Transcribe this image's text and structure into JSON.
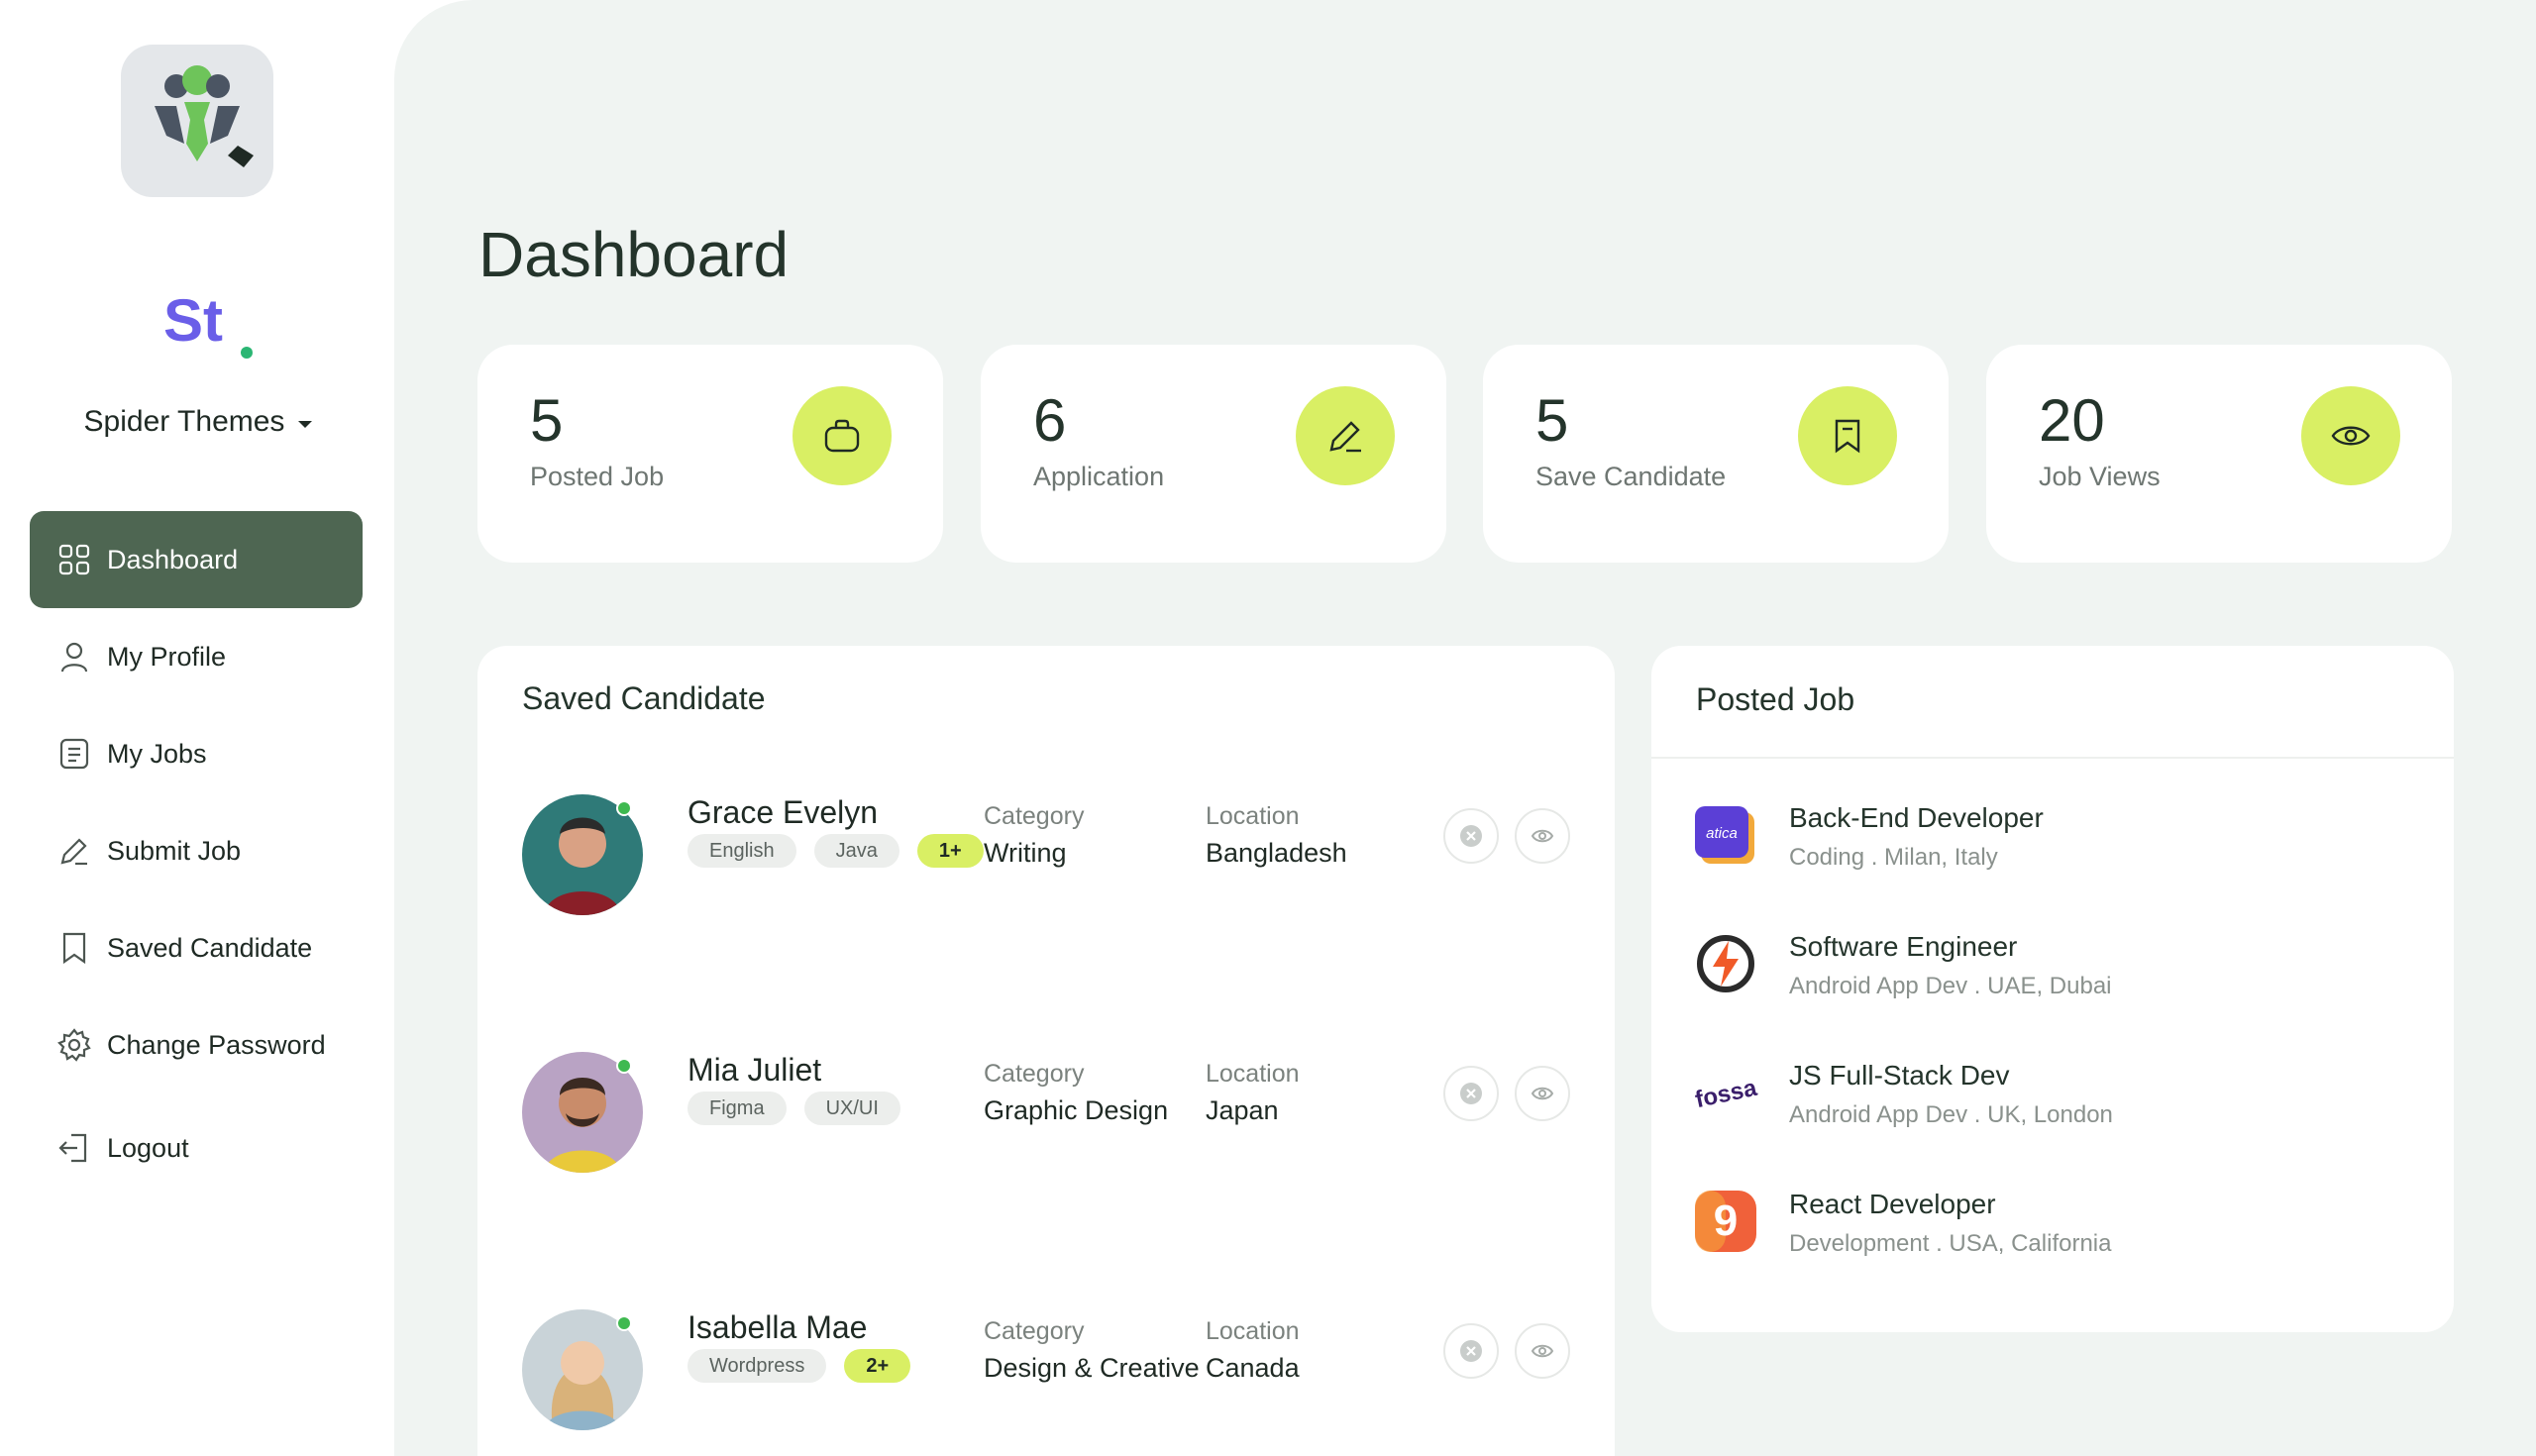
{
  "brand": {
    "name": "Spider Themes",
    "logo_text": "St"
  },
  "sidebar": {
    "items": [
      {
        "label": "Dashboard",
        "icon": "grid-icon",
        "active": true
      },
      {
        "label": "My Profile",
        "icon": "user-icon"
      },
      {
        "label": "My Jobs",
        "icon": "document-icon"
      },
      {
        "label": "Submit Job",
        "icon": "pencil-icon"
      },
      {
        "label": "Saved Candidate",
        "icon": "bookmark-icon"
      },
      {
        "label": "Change Password",
        "icon": "gear-icon"
      },
      {
        "label": "Logout",
        "icon": "logout-icon"
      }
    ]
  },
  "page": {
    "title": "Dashboard"
  },
  "stats": [
    {
      "value": "5",
      "label": "Posted Job",
      "icon": "briefcase-icon"
    },
    {
      "value": "6",
      "label": "Application",
      "icon": "pencil-icon"
    },
    {
      "value": "5",
      "label": "Save Candidate",
      "icon": "bookmark-icon"
    },
    {
      "value": "20",
      "label": "Job Views",
      "icon": "eye-icon"
    }
  ],
  "saved_candidate": {
    "title": "Saved Candidate",
    "category_label": "Category",
    "location_label": "Location",
    "candidates": [
      {
        "name": "Grace Evelyn",
        "tags": [
          "English",
          "Java"
        ],
        "more": "1+",
        "category": "Writing",
        "location": "Bangladesh"
      },
      {
        "name": "Mia Juliet",
        "tags": [
          "Figma",
          "UX/UI"
        ],
        "more": "",
        "category": "Graphic Design",
        "location": "Japan"
      },
      {
        "name": "Isabella Mae",
        "tags": [
          "Wordpress"
        ],
        "more": "2+",
        "category": "Design & Creative",
        "location": "Canada"
      }
    ]
  },
  "posted_job": {
    "title": "Posted Job",
    "jobs": [
      {
        "title": "Back-End Developer",
        "subtitle": "Coding . Milan, Italy",
        "logo_text": "atica"
      },
      {
        "title": "Software Engineer",
        "subtitle": "Android App Dev . UAE, Dubai"
      },
      {
        "title": "JS Full-Stack Dev",
        "subtitle": "Android App Dev . UK, London",
        "logo_text": "fossa"
      },
      {
        "title": "React Developer",
        "subtitle": "Development . USA, California",
        "logo_text": "9"
      }
    ]
  },
  "colors": {
    "accent": "#d9ef64",
    "active_nav": "#4e6652",
    "main_bg": "#f0f4f2",
    "online": "#3fb950"
  }
}
